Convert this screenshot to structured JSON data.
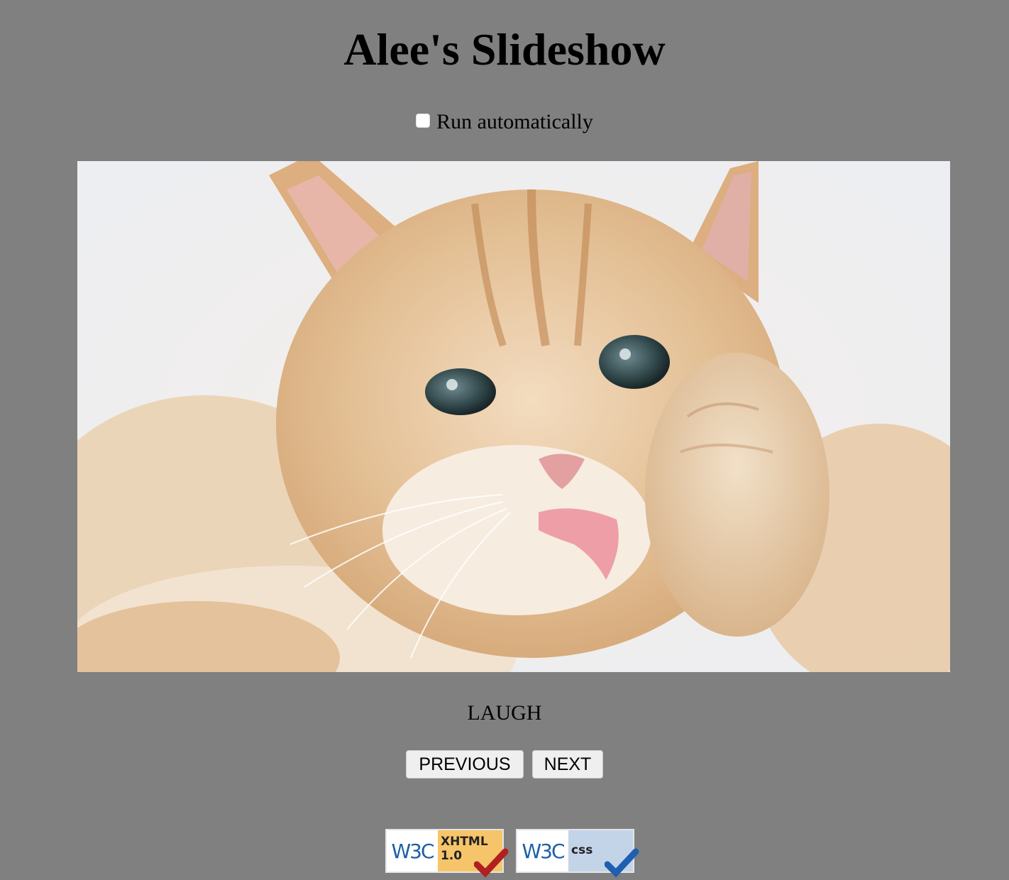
{
  "page": {
    "title": "Alee's Slideshow",
    "background": "#808080"
  },
  "controls": {
    "auto_label": "Run automatically",
    "auto_checked": false,
    "previous_label": "PREVIOUS",
    "next_label": "NEXT"
  },
  "slide": {
    "image_subject": "kitten-licking-paw-photo",
    "caption": "LAUGH"
  },
  "badges": [
    {
      "name": "w3c-xhtml-badge",
      "logo_text": "W3C",
      "line1": "XHTML",
      "line2": "1.0",
      "check_color": "#b02020",
      "accent": "#f6c56a"
    },
    {
      "name": "w3c-css-badge",
      "logo_text": "W3C",
      "line1": "css",
      "line2": "",
      "check_color": "#1f5fb0",
      "accent": "#c4d4e8"
    }
  ]
}
